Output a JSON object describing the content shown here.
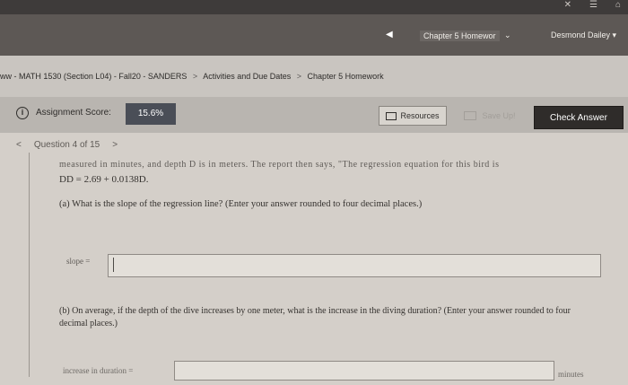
{
  "topbar": {
    "icons": [
      "✕",
      "☰",
      "⌂"
    ]
  },
  "nav": {
    "back_arrow": "◀",
    "chapter_title": "Chapter 5 Homewor",
    "chapter_caret": "⌄",
    "user_name": "Desmond Dailey ▾"
  },
  "breadcrumb": {
    "course": "ww - MATH 1530 (Section L04) - Fall20 - SANDERS",
    "sep": ">",
    "activities": "Activities and Due Dates",
    "chapter": "Chapter 5 Homework"
  },
  "scorebar": {
    "info_glyph": "i",
    "score_label": "Assignment Score:",
    "score_value": "15.6%",
    "resources_label": "Resources",
    "save_label": "Save Up!",
    "check_label": "Check Answer"
  },
  "question": {
    "prev_glyph": "<",
    "label": "Question 4 of 15",
    "next_glyph": ">",
    "cut_text": "measured in minutes, and depth D is in meters. The report then says, \"The regression equation for this bird is",
    "equation": "DD = 2.69 + 0.0138D.",
    "part_a": "(a) What is the slope of the regression line? (Enter your answer rounded to four decimal places.)",
    "slope_label": "slope =",
    "slope_value": "",
    "part_b": "(b) On average, if the depth of the dive increases by one meter, what is the increase in the diving duration? (Enter your answer rounded to four decimal places.)",
    "increase_label": "increase in duration =",
    "increase_value": "",
    "units": "minutes"
  }
}
